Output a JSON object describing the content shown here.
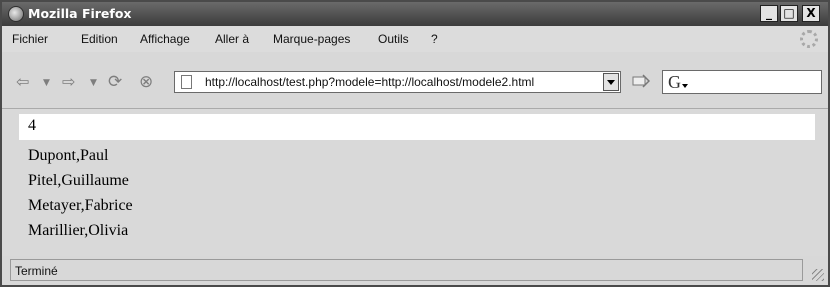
{
  "window": {
    "title": "Mozilla Firefox",
    "controls": [
      "_",
      "□",
      "X"
    ]
  },
  "menu": {
    "items": [
      "Fichier",
      "Edition",
      "Affichage",
      "Aller à",
      "Marque-pages",
      "Outils",
      "?"
    ]
  },
  "toolbar": {
    "url": "http://localhost/test.php?modele=http://localhost/modele2.html",
    "search_engine_glyph": "G"
  },
  "page": {
    "count": "4",
    "names": [
      "Dupont,Paul",
      "Pitel,Guillaume",
      "Metayer,Fabrice",
      "Marillier,Olivia"
    ]
  },
  "status": {
    "text": "Terminé"
  }
}
